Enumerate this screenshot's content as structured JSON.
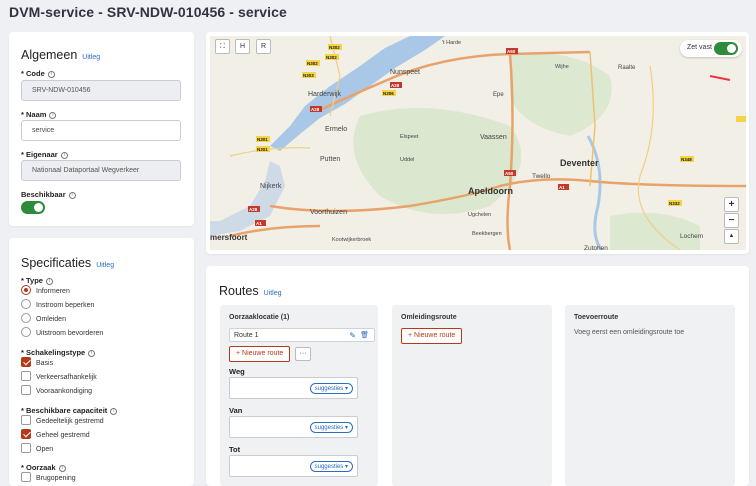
{
  "page": {
    "title": "DVM-service - SRV-NDW-010456 - service"
  },
  "algemeen": {
    "heading": "Algemeen",
    "help": "Uitleg",
    "code": {
      "label": "Code",
      "value": "SRV-NDW-010456"
    },
    "naam": {
      "label": "Naam",
      "value": "service"
    },
    "eigenaar": {
      "label": "Eigenaar",
      "value": "Nationaal Dataportaal Wegverkeer"
    },
    "beschikbaar": {
      "label": "Beschikbaar",
      "on": true
    }
  },
  "specificaties": {
    "heading": "Specificaties",
    "help": "Uitleg",
    "type": {
      "label": "Type",
      "options": [
        "Informeren",
        "Instroom beperken",
        "Omleiden",
        "Uitstroom bevorderen"
      ],
      "selected": "Informeren"
    },
    "schakelingstype": {
      "label": "Schakelingstype",
      "options": [
        "Basis",
        "Verkeersafhankelijk",
        "Vooraankondiging"
      ],
      "checked": [
        "Basis"
      ]
    },
    "capaciteit": {
      "label": "Beschikbare capaciteit",
      "options": [
        "Gedeeltelijk gestremd",
        "Geheel gestremd",
        "Open"
      ],
      "checked": [
        "Geheel gestremd"
      ]
    },
    "oorzaak": {
      "label": "Oorzaak",
      "options": [
        "Brugopening"
      ]
    },
    "required_marker": "*"
  },
  "map": {
    "fullscreen_icon": "expand-icon",
    "btn_h": "H",
    "btn_r": "R",
    "zet_vast": {
      "label": "Zet vast",
      "on": true
    },
    "zoom_in": "+",
    "zoom_out": "−",
    "compass": "▲",
    "places": [
      "'t Harde",
      "Harderwijk",
      "Nunspeet",
      "Wijhe",
      "Raalte",
      "Epe",
      "Ermelo",
      "Elspeet",
      "Vaassen",
      "Putten",
      "Uddel",
      "Deventer",
      "Twello",
      "Nijkerk",
      "Apeldoorn",
      "Voorthuizen",
      "Ugchelen",
      "mersfoort",
      "Kootwijkerbroek",
      "Beekbergen",
      "Zutphen",
      "Lochem"
    ],
    "roads": [
      "N302",
      "N306",
      "A28",
      "N303",
      "N310",
      "N301",
      "A50",
      "A1",
      "N344",
      "N332",
      "N348",
      "A28",
      "A1",
      "A50"
    ],
    "colors": {
      "water": "#a9c8e8",
      "land": "#f2efe6",
      "forest": "#d4e4c8",
      "motorway": "#e8a36a"
    }
  },
  "routes": {
    "heading": "Routes",
    "help": "Uitleg",
    "oorzaak": {
      "header": "Oorzaaklocatie (1)",
      "route_name": "Route 1",
      "edit_icon": "pencil-icon",
      "delete_icon": "trash-icon",
      "new_route": "+ Nieuwe route",
      "more": "···",
      "weg_label": "Weg",
      "van_label": "Van",
      "tot_label": "Tot",
      "suggesties": "suggesties ▾"
    },
    "omleiding": {
      "header": "Omleidingsroute",
      "new_route": "+ Nieuwe route"
    },
    "toevoer": {
      "header": "Toevoerroute",
      "message": "Voeg eerst een omleidingsroute toe"
    }
  }
}
